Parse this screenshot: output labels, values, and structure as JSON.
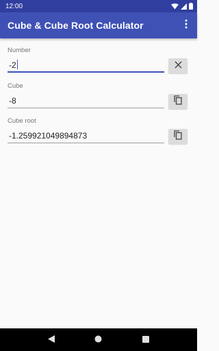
{
  "status_bar": {
    "time": "12:00",
    "icons": [
      "wifi-icon",
      "signal-icon",
      "battery-icon"
    ]
  },
  "app_bar": {
    "title": "Cube & Cube Root Calculator",
    "overflow_icon": "more-vert-icon"
  },
  "fields": {
    "number": {
      "label": "Number",
      "value": "-2",
      "action_icon": "clear-icon"
    },
    "cube": {
      "label": "Cube",
      "value": "-8",
      "action_icon": "copy-icon"
    },
    "cube_root": {
      "label": "Cube root",
      "value": "-1.259921049894873",
      "action_icon": "copy-icon"
    }
  },
  "nav_bar": {
    "icons": [
      "back-icon",
      "home-icon",
      "recents-icon"
    ]
  },
  "colors": {
    "primary": "#3f51b5",
    "primary_dark": "#303f9f",
    "background": "#fafafa",
    "button_gray": "#dcdcdc"
  }
}
